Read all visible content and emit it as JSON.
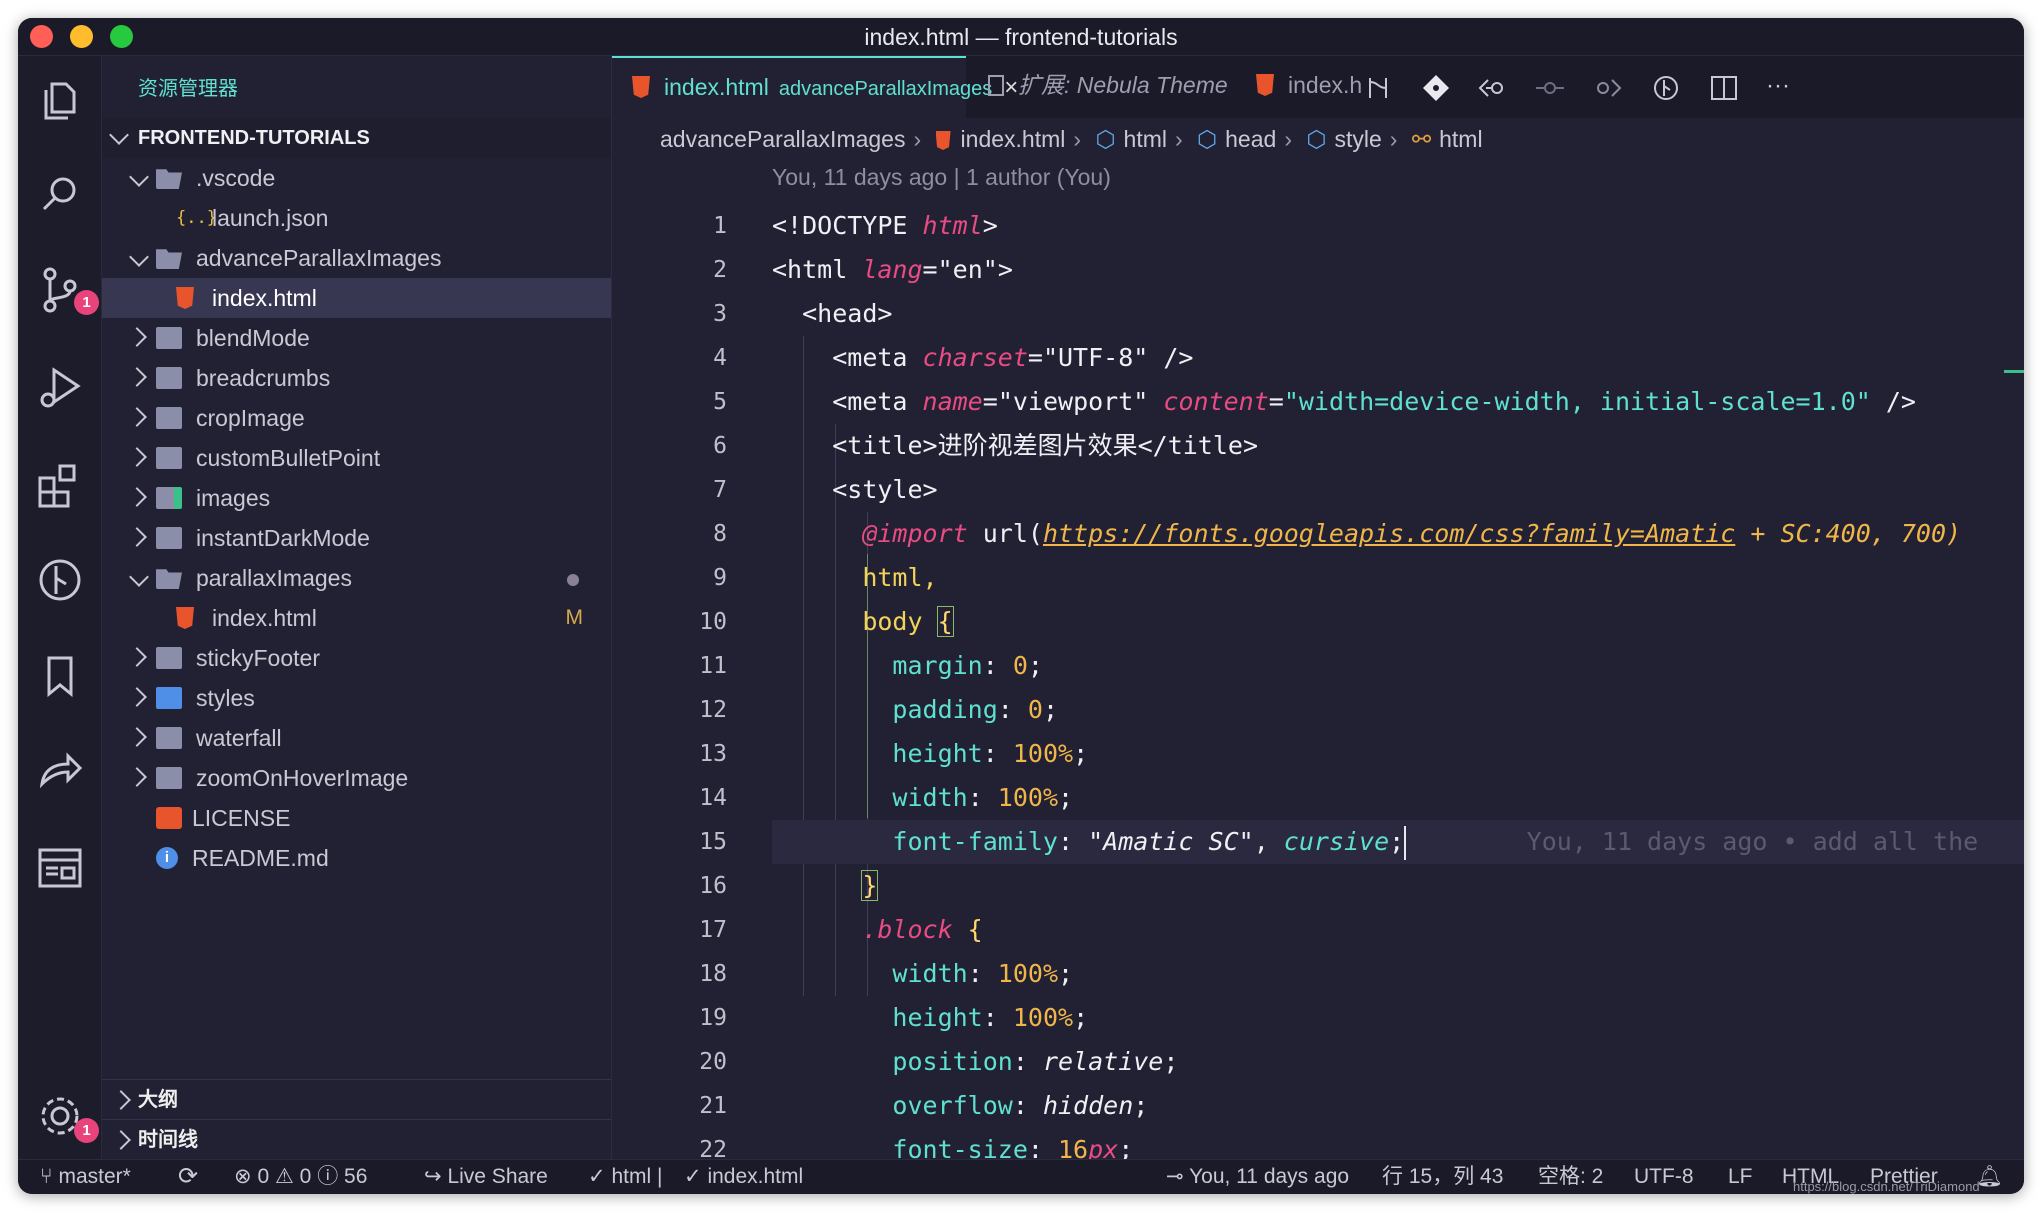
{
  "window": {
    "title": "index.html — frontend-tutorials"
  },
  "colors": {
    "accent": "#5fe0d0",
    "tag": "#e8e8ee",
    "attr": "#e94b83",
    "number": "#f0b64a",
    "badge": "#e8447b",
    "close": "#ff5f56",
    "minimize": "#ffbd2e",
    "maximize": "#27c93f"
  },
  "activity_bar": {
    "icons": [
      "files-icon",
      "search-icon",
      "source-control-icon",
      "run-debug-icon",
      "extensions-icon",
      "git-graph-icon",
      "bookmarks-icon",
      "live-share-icon",
      "remote-explorer-icon",
      "settings-icon"
    ],
    "source_control_badge": "1",
    "settings_badge": "1"
  },
  "sidebar": {
    "title": "资源管理器",
    "root": "FRONTEND-TUTORIALS",
    "items": [
      {
        "label": ".vscode",
        "kind": "folder-open",
        "depth": 1
      },
      {
        "label": "launch.json",
        "kind": "json",
        "depth": 2
      },
      {
        "label": "advanceParallaxImages",
        "kind": "folder-open",
        "depth": 1
      },
      {
        "label": "index.html",
        "kind": "html",
        "depth": 2,
        "selected": true
      },
      {
        "label": "blendMode",
        "kind": "folder",
        "depth": 1
      },
      {
        "label": "breadcrumbs",
        "kind": "folder",
        "depth": 1
      },
      {
        "label": "cropImage",
        "kind": "folder",
        "depth": 1
      },
      {
        "label": "customBulletPoint",
        "kind": "folder",
        "depth": 1
      },
      {
        "label": "images",
        "kind": "folder-images",
        "depth": 1
      },
      {
        "label": "instantDarkMode",
        "kind": "folder",
        "depth": 1
      },
      {
        "label": "parallaxImages",
        "kind": "folder-open",
        "depth": 1,
        "modified_dot": true
      },
      {
        "label": "index.html",
        "kind": "html",
        "depth": 2,
        "badge": "M"
      },
      {
        "label": "stickyFooter",
        "kind": "folder",
        "depth": 1
      },
      {
        "label": "styles",
        "kind": "folder-styles",
        "depth": 1
      },
      {
        "label": "waterfall",
        "kind": "folder",
        "depth": 1
      },
      {
        "label": "zoomOnHoverImage",
        "kind": "folder",
        "depth": 1
      },
      {
        "label": "LICENSE",
        "kind": "license",
        "depth": 1
      },
      {
        "label": "README.md",
        "kind": "info",
        "depth": 1
      }
    ],
    "outline": "大纲",
    "timeline": "时间线"
  },
  "tabs": [
    {
      "label": "index.html",
      "sub": "advanceParallaxImages",
      "close": "×",
      "active": true
    },
    {
      "label": "扩展: Nebula Theme",
      "active": false
    },
    {
      "label": "index.h",
      "active": false
    }
  ],
  "toolbar_icons": [
    "compare-changes-icon",
    "git-commit-icon",
    "go-back-icon",
    "timeline-dot-icon",
    "go-forward-icon",
    "open-changes-icon",
    "split-editor-icon",
    "more-actions-icon"
  ],
  "toolbar_more": "···",
  "breadcrumb": [
    "advanceParallaxImages",
    "index.html",
    "html",
    "head",
    "style",
    "html"
  ],
  "codelens": "You, 11 days ago | 1 author (You)",
  "line_numbers": [
    "1",
    "2",
    "3",
    "4",
    "5",
    "6",
    "7",
    "8",
    "9",
    "10",
    "11",
    "12",
    "13",
    "14",
    "15",
    "16",
    "17",
    "18",
    "19",
    "20",
    "21",
    "22"
  ],
  "code": {
    "l1": {
      "open": "<!DOCTYPE ",
      "kw": "html",
      "close": ">"
    },
    "l2": {
      "open": "<html ",
      "attr": "lang",
      "eq": "=",
      "val": "\"en\"",
      "close": ">"
    },
    "l3": {
      "text": "<head>"
    },
    "l4": {
      "open": "<meta ",
      "attr": "charset",
      "eq": "=",
      "val": "\"UTF-8\"",
      "close": " />"
    },
    "l5": {
      "open": "<meta ",
      "attr1": "name",
      "eq1": "=",
      "val1": "\"viewport\"",
      "attr2": "content",
      "eq2": "=",
      "val2": "\"width=device-width, initial-scale=1.0\"",
      "close": " />"
    },
    "l6": {
      "open": "<title>",
      "text": "进阶视差图片效果",
      "close": "</title>"
    },
    "l7": {
      "text": "<style>"
    },
    "l8": {
      "at": "@import",
      "fn": " url(",
      "url": "https://fonts.googleapis.com/css?family=Amatic",
      "rest": " + SC:400, 700)"
    },
    "l9": {
      "text": "html,"
    },
    "l10": {
      "sel": "body ",
      "brace": "{"
    },
    "l11": {
      "prop": "margin",
      "colon": ": ",
      "num": "0",
      "semi": ";"
    },
    "l12": {
      "prop": "padding",
      "colon": ": ",
      "num": "0",
      "semi": ";"
    },
    "l13": {
      "prop": "height",
      "colon": ": ",
      "num": "100%",
      "semi": ";"
    },
    "l14": {
      "prop": "width",
      "colon": ": ",
      "num": "100%",
      "semi": ";"
    },
    "l15": {
      "prop": "font-family",
      "colon": ": ",
      "str": "\"Amatic SC\"",
      "comma": ", ",
      "kw": "cursive",
      "semi": ";",
      "blame": "You, 11 days ago • add all the"
    },
    "l16": {
      "brace": "}"
    },
    "l17": {
      "sel": ".block",
      "brace": " {"
    },
    "l18": {
      "prop": "width",
      "colon": ": ",
      "num": "100%",
      "semi": ";"
    },
    "l19": {
      "prop": "height",
      "colon": ": ",
      "num": "100%",
      "semi": ";"
    },
    "l20": {
      "prop": "position",
      "colon": ": ",
      "kw": "relative",
      "semi": ";"
    },
    "l21": {
      "prop": "overflow",
      "colon": ": ",
      "kw": "hidden",
      "semi": ";"
    },
    "l22": {
      "prop": "font-size",
      "colon": ": ",
      "num": "16",
      "unit": "px",
      "semi": ";"
    }
  },
  "statusbar": {
    "branch": "master*",
    "errors": "0",
    "warnings": "0",
    "infos": "56",
    "live_share": "Live Share",
    "check1": "html |",
    "check2": "index.html",
    "blame": "You, 11 days ago",
    "position": "行 15，列 43",
    "spaces": "空格: 2",
    "encoding": "UTF-8",
    "eol": "LF",
    "language": "HTML",
    "formatter": "Prettier",
    "watermark": "https://blog.csdn.net/TriDiamond"
  }
}
